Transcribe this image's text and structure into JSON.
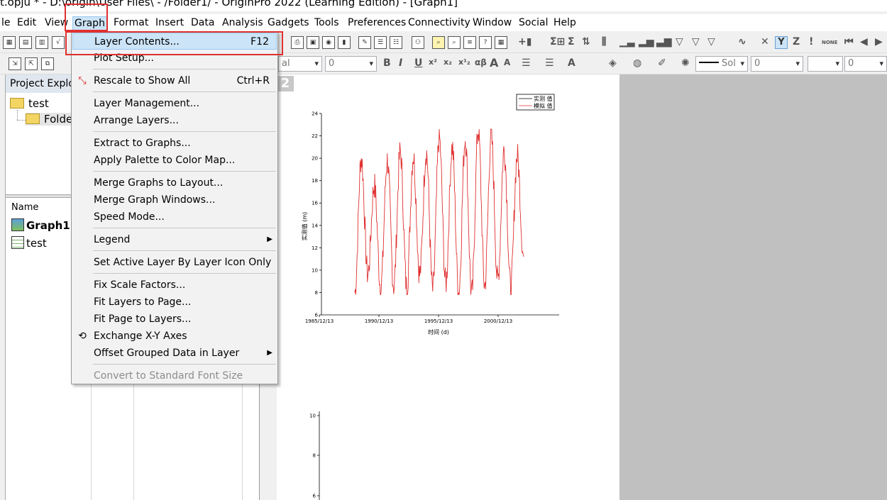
{
  "window": {
    "title": "t.opju * - D:\\origin\\User Files\\ - /Folder1/ - OriginPro 2022 (Learning Edition) - [Graph1]"
  },
  "menubar": {
    "items": [
      {
        "label": "le"
      },
      {
        "label": "Edit"
      },
      {
        "label": "View"
      },
      {
        "label": "Graph"
      },
      {
        "label": "Format"
      },
      {
        "label": "Insert"
      },
      {
        "label": "Data"
      },
      {
        "label": "Analysis"
      },
      {
        "label": "Gadgets"
      },
      {
        "label": "Tools"
      },
      {
        "label": "Preferences"
      },
      {
        "label": "Connectivity"
      },
      {
        "label": "Window"
      },
      {
        "label": "Social"
      },
      {
        "label": "Help"
      }
    ],
    "active": "Graph"
  },
  "format_toolbar": {
    "font_combo": "al",
    "size_combo": "0",
    "style_buttons": [
      "B",
      "I",
      "U",
      "x²",
      "x₂",
      "x¹₂",
      "αβ",
      "A",
      "A"
    ],
    "line_style_combo": "Sol",
    "line_width_combo": "0",
    "width_combo2": "0"
  },
  "project_explorer": {
    "title": "Project Explore",
    "tree": [
      {
        "label": "test"
      },
      {
        "label": "Folde"
      }
    ],
    "list_header": "Name",
    "list": [
      {
        "label": "Graph1",
        "bold": true
      },
      {
        "label": "test",
        "bold": false
      }
    ]
  },
  "graph_menu": {
    "items": [
      {
        "label": "Layer Contents...",
        "shortcut": "F12",
        "highlighted": true
      },
      {
        "label": "Plot Setup..."
      },
      {
        "label": "Rescale to Show All",
        "shortcut": "Ctrl+R"
      },
      {
        "label": "Layer Management..."
      },
      {
        "label": "Arrange Layers..."
      },
      {
        "label": "Extract to Graphs..."
      },
      {
        "label": "Apply Palette to Color Map..."
      },
      {
        "label": "Merge Graphs to Layout..."
      },
      {
        "label": "Merge Graph Windows..."
      },
      {
        "label": "Speed Mode..."
      },
      {
        "label": "Legend",
        "submenu": true
      },
      {
        "label": "Set Active Layer By Layer Icon Only"
      },
      {
        "label": "Fix Scale Factors..."
      },
      {
        "label": "Fit Layers to Page..."
      },
      {
        "label": "Fit Page to Layers..."
      },
      {
        "label": "Exchange X-Y Axes"
      },
      {
        "label": "Offset Grouped Data in Layer",
        "submenu": true
      },
      {
        "label": "Convert to Standard Font Size",
        "disabled": true
      }
    ]
  },
  "graph": {
    "layer_tab": "2",
    "legend": [
      "实测 值",
      "模拟 值"
    ],
    "colors": {
      "observed": "#000000",
      "simulated": "#e03030"
    }
  },
  "chart_data": [
    {
      "type": "line",
      "xlabel": "时间 (d)",
      "ylabel": "实测值 (m)",
      "x_ticks": [
        "1985/12/13",
        "1990/12/13",
        "1995/12/13",
        "2000/12/13"
      ],
      "y_ticks": [
        6,
        8,
        10,
        12,
        14,
        16,
        18,
        20,
        22,
        24
      ],
      "ylim": [
        6,
        24
      ],
      "series": [
        {
          "name": "实测 值",
          "values": []
        },
        {
          "name": "模拟 值",
          "x_start": "1988/03",
          "x_end": "2004/09",
          "min": 7.8,
          "max": 22.6,
          "peaks": [
            20,
            17.6,
            19.8,
            20.6,
            20.2,
            20.6,
            21.8,
            21,
            21.8,
            22.6,
            22,
            20.8,
            20.2
          ],
          "troughs": [
            8,
            9.6,
            8.4,
            8.6,
            8.4,
            9.6,
            8.2,
            8.8,
            8,
            7.8,
            8.6,
            9,
            8.4,
            11.2
          ]
        }
      ]
    },
    {
      "type": "line",
      "y_ticks": [
        6,
        8,
        10
      ],
      "series": []
    }
  ]
}
